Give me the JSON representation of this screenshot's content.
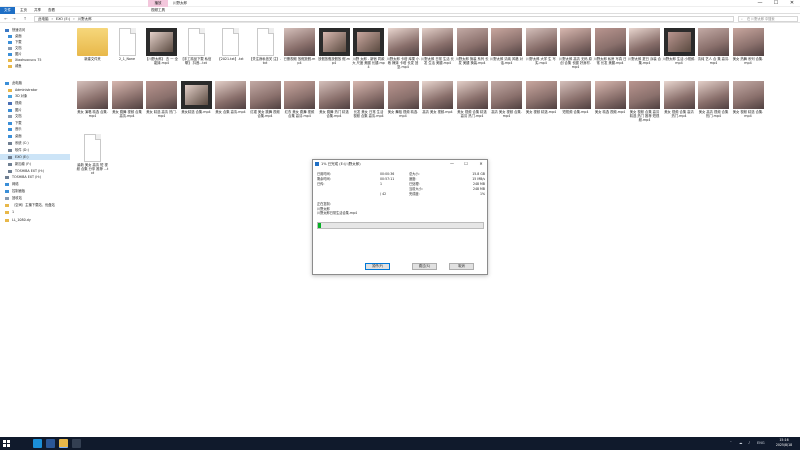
{
  "window": {
    "tools_tab": "播放",
    "title": "川野太郎",
    "minimize": "—",
    "maximize": "☐",
    "close": "✕"
  },
  "ribbon": {
    "tabs": [
      "文件",
      "主页",
      "共享",
      "查看",
      "视频工具"
    ]
  },
  "address": {
    "back": "←",
    "forward": "→",
    "up": "↑",
    "crumbs": [
      "此电脑",
      "›",
      "EXO (E:)",
      "›",
      "川野太郎"
    ],
    "search_placeholder": "在 川野太郎 中搜索"
  },
  "sidebar": {
    "items": [
      {
        "label": "快速访问",
        "icon": "star-icon",
        "color": "#3b78c4"
      },
      {
        "label": "桌面",
        "icon": "desktop-icon",
        "color": "#3b8fd8"
      },
      {
        "label": "下载",
        "icon": "download-icon",
        "color": "#3b8fd8"
      },
      {
        "label": "文档",
        "icon": "document-icon",
        "color": "#8a9bb0"
      },
      {
        "label": "图片",
        "icon": "picture-icon",
        "color": "#3b8fd8"
      },
      {
        "label": "Xiaohuocucu 75",
        "icon": "folder-icon",
        "color": "#e8b84a"
      },
      {
        "label": "咸鱼",
        "icon": "folder-icon",
        "color": "#e8b84a"
      },
      {
        "label": "此电脑",
        "icon": "computer-icon",
        "color": "#3b8fd8"
      },
      {
        "label": "Administrator",
        "icon": "user-folder-icon",
        "color": "#e8b84a"
      },
      {
        "label": "3D 对象",
        "icon": "cube-icon",
        "color": "#4aa3df"
      },
      {
        "label": "视频",
        "icon": "video-icon",
        "color": "#4a6fb5"
      },
      {
        "label": "图片",
        "icon": "picture-icon",
        "color": "#3b8fd8"
      },
      {
        "label": "文档",
        "icon": "document-icon",
        "color": "#8a9bb0"
      },
      {
        "label": "下载",
        "icon": "download-icon",
        "color": "#3b8fd8"
      },
      {
        "label": "音乐",
        "icon": "music-icon",
        "color": "#3b8fd8"
      },
      {
        "label": "桌面",
        "icon": "desktop-icon",
        "color": "#3b8fd8"
      },
      {
        "label": "系统 (C:)",
        "icon": "drive-icon",
        "color": "#6f7f92"
      },
      {
        "label": "软件 (D:)",
        "icon": "drive-icon",
        "color": "#6f7f92"
      },
      {
        "label": "EXO (E:)",
        "icon": "drive-icon",
        "color": "#6f7f92"
      },
      {
        "label": "新加卷 (F:)",
        "icon": "drive-icon",
        "color": "#6f7f92"
      },
      {
        "label": "TOSHIBA EXT (H:)",
        "icon": "drive-icon",
        "color": "#6f7f92"
      },
      {
        "label": "TOSHIBA EXT (H:)",
        "icon": "drive-icon",
        "color": "#6f7f92"
      },
      {
        "label": "网络",
        "icon": "network-icon",
        "color": "#3b8fd8"
      },
      {
        "label": "控制面板",
        "icon": "control-panel-icon",
        "color": "#3b8fd8"
      },
      {
        "label": "回收站",
        "icon": "recycle-bin-icon",
        "color": "#8a9bb0"
      },
      {
        "label": "（空间）主播下载站、优盘站",
        "icon": "folder-icon",
        "color": "#e8b84a"
      },
      {
        "label": "1",
        "icon": "folder-icon",
        "color": "#e8b84a"
      },
      {
        "label": "LL_1080.dy",
        "icon": "folder-icon",
        "color": "#e8b84a"
      }
    ]
  },
  "files": [
    {
      "label": "新建文件夹",
      "kind": "folder"
    },
    {
      "label": "2_1_None",
      "kind": "doc"
    },
    {
      "label": "【川野太郎】 去 一 全能妹.mp4",
      "kind": "film"
    },
    {
      "label": "【手工精品下载 私信聊】 抖音...txt",
      "kind": "doc"
    },
    {
      "label": "【2021.txt】.txt",
      "kind": "doc"
    },
    {
      "label": "【关注我私信关 注】.txt",
      "kind": "doc"
    },
    {
      "label": "已删视频 放假放假.mp4",
      "kind": "photo"
    },
    {
      "label": "放假放假放假放 假.mp4",
      "kind": "film"
    },
    {
      "label": "川野 太郎 - 新宿 同款大 尺度 美腿 长腿.mp4",
      "kind": "film"
    },
    {
      "label": "川野太郎 卡塔 库栗 小巷 辣妹 卡塔 长发 回复.mp4",
      "kind": "photo"
    },
    {
      "label": "川野太郎 日常 生活 长发 生活 美腿.mp4",
      "kind": "photo"
    },
    {
      "label": "川野太郎 换装 系列 长发 美腿 换装.mp4",
      "kind": "photo"
    },
    {
      "label": "川野太郎 清纯 风格 对话.mp4",
      "kind": "photo"
    },
    {
      "label": "川野太郎 大学 生 写实.mp4",
      "kind": "photo"
    },
    {
      "label": "川野太郎 高清 无码 原创 合集 长腿 好身材.mp4",
      "kind": "photo"
    },
    {
      "label": "川野太郎 私房 写真 日常 长发 美腿.mp4",
      "kind": "photo"
    },
    {
      "label": "川野太郎 夏日 泳装 合集.mp4",
      "kind": "photo"
    },
    {
      "label": "川野太郎 生活 小视频.mp4",
      "kind": "film"
    },
    {
      "label": "清纯 艺人 合 集 高清.mp4",
      "kind": "photo"
    },
    {
      "label": "美女 热舞 系列 合集.mp4",
      "kind": "photo"
    },
    {
      "label": "美女 演唱 精选 合集.mp4",
      "kind": "photo"
    },
    {
      "label": "美女 跳舞 视频 合集 高清.mp4",
      "kind": "photo"
    },
    {
      "label": "美女 精选 高清 热门.mp4",
      "kind": "photo"
    },
    {
      "label": "美女精选 合集.mp4",
      "kind": "film"
    },
    {
      "label": "美女 合集 高清.mp4",
      "kind": "photo"
    },
    {
      "label": "红裙 美女 跳舞 视频 合集.mp4",
      "kind": "photo"
    },
    {
      "label": "红衣 美女 跳舞 视频 合集 高清.mp4",
      "kind": "photo"
    },
    {
      "label": "美女 跳舞 热门 精选 合集.mp4",
      "kind": "photo"
    },
    {
      "label": "长发 美女 日常 生活 视频 合集 高清.mp4",
      "kind": "photo"
    },
    {
      "label": "美女 舞蹈 视频 精选.mp4",
      "kind": "photo"
    },
    {
      "label": "高清 美女 视频.mp4",
      "kind": "photo"
    },
    {
      "label": "美女 视频 合集 精选 高清 热门.mp4",
      "kind": "photo"
    },
    {
      "label": "高清 美女 视频 合集.mp4",
      "kind": "photo"
    },
    {
      "label": "美女 视频 精选.mp4",
      "kind": "photo"
    },
    {
      "label": "短视频 合集.mp4",
      "kind": "photo"
    },
    {
      "label": "美女 精选 视频.mp4",
      "kind": "photo"
    },
    {
      "label": "美女 视频 合集 高清 精选 热门 推荐 短视频.mp4",
      "kind": "photo"
    },
    {
      "label": "美女 视频 合集 高清 热门.mp4",
      "kind": "photo"
    },
    {
      "label": "美女 高清 视频 合集 热门.mp4",
      "kind": "photo"
    },
    {
      "label": "美女 视频 精选 合集.mp4",
      "kind": "photo"
    },
    {
      "label": "最新 美女 高清 短 视频 合集 分享 推荐 ...txt",
      "kind": "doc"
    }
  ],
  "dialog": {
    "title": "1% 已完成 (E:\\川野太郎)",
    "minimize": "—",
    "maximize": "☐",
    "close": "✕",
    "left_rows": [
      {
        "k": "已用时间:",
        "v": "00:00:36"
      },
      {
        "k": "剩余时间:",
        "v": "00:57:11"
      },
      {
        "k": "已传:",
        "v": "1"
      },
      {
        "k": "",
        "v": ""
      },
      {
        "k": "",
        "v": "/ 42"
      }
    ],
    "right_rows": [
      {
        "k": "总大小:",
        "v": "15.8 GB"
      },
      {
        "k": "速度:",
        "v": "15 MB/s"
      },
      {
        "k": "已处理:",
        "v": "248 MB"
      },
      {
        "k": "当前大小:",
        "v": "248 MB"
      },
      {
        "k": "完成度:",
        "v": "1%"
      }
    ],
    "file_lines": [
      "正在复制:",
      "川野太郎",
      "川野太郎日常生活合集.mp4"
    ],
    "progress": 0.02,
    "progress_color": "#06b025",
    "buttons": [
      "暂停(P)",
      "跳过(S)",
      "取消"
    ]
  },
  "taskbar": {
    "apps": [
      {
        "icon": "search-icon",
        "color": "#101a2c"
      },
      {
        "icon": "edge-icon",
        "color": "#1b8fd8"
      },
      {
        "icon": "word-icon",
        "color": "#2b5797"
      },
      {
        "icon": "file-explorer-icon",
        "color": "#e8b84a"
      },
      {
        "icon": "app-icon",
        "color": "#333f52"
      }
    ],
    "time": "15:16",
    "date": "2025/8/18",
    "tray": [
      "˄",
      "☁",
      "♪",
      "ENG"
    ]
  }
}
